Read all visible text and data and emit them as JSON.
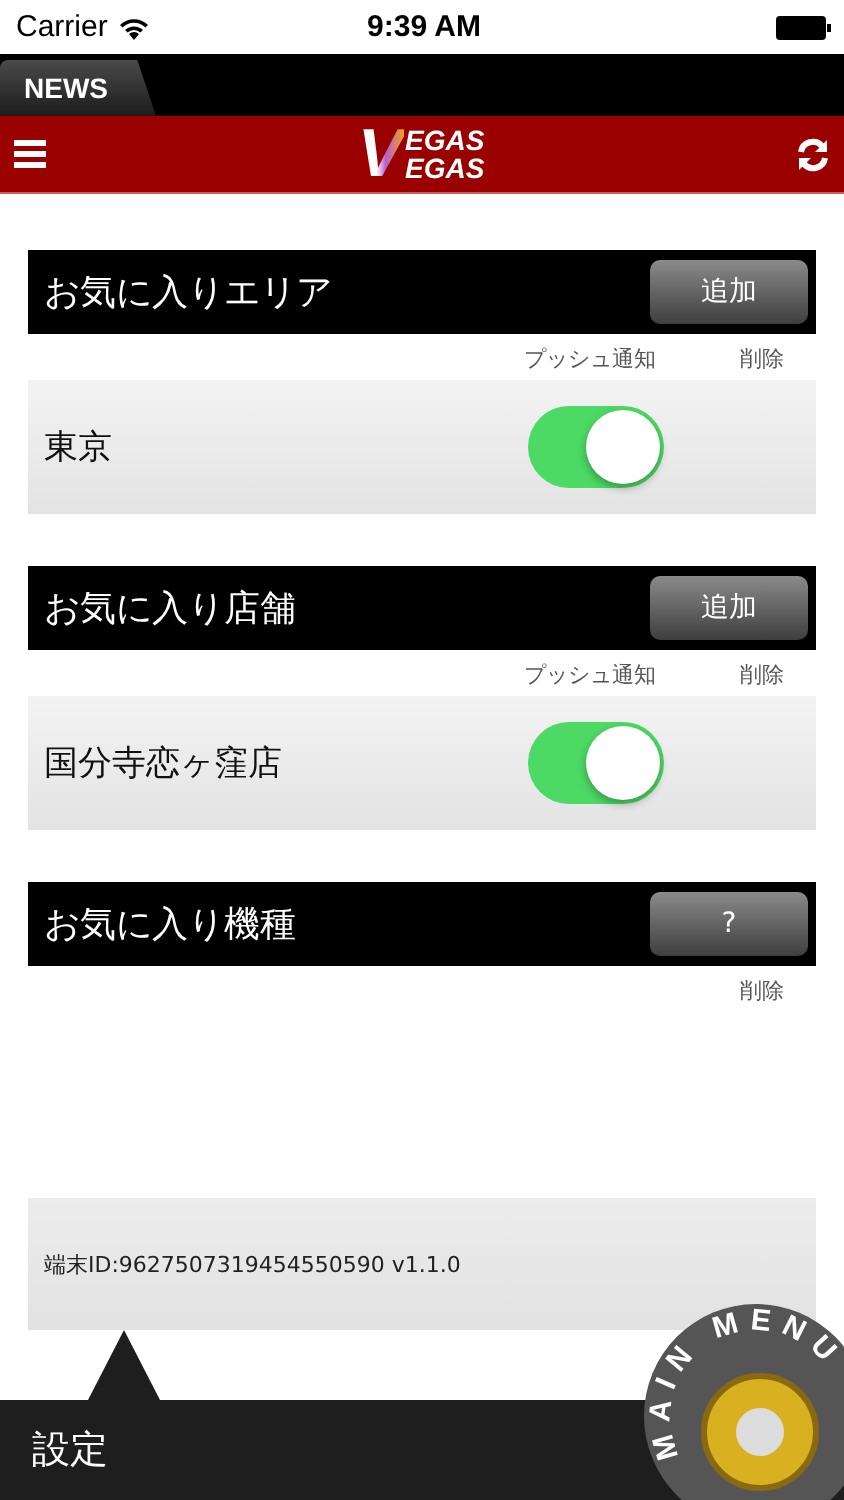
{
  "status_bar": {
    "carrier": "Carrier",
    "time": "9:39 AM"
  },
  "news_tab": {
    "label": "NEWS"
  },
  "nav": {
    "logo": {
      "initial": "V",
      "top": "EGAS",
      "bottom": "EGAS"
    }
  },
  "sections": [
    {
      "title": "お気に入りエリア",
      "button": "追加",
      "columns": [
        {
          "kind": "push",
          "label": "プッシュ通知"
        },
        {
          "kind": "delete",
          "label": "削除"
        }
      ],
      "items": [
        {
          "name": "東京",
          "push_on": true
        }
      ]
    },
    {
      "title": "お気に入り店舗",
      "button": "追加",
      "columns": [
        {
          "kind": "push",
          "label": "プッシュ通知"
        },
        {
          "kind": "delete",
          "label": "削除"
        }
      ],
      "items": [
        {
          "name": "国分寺恋ヶ窪店",
          "push_on": true
        }
      ]
    },
    {
      "title": "お気に入り機種",
      "button": "?",
      "columns": [
        {
          "kind": "delete",
          "label": "削除"
        }
      ]
    }
  ],
  "device_info": "端末ID:9627507319454550590 v1.1.0",
  "bottom_bar": {
    "title": "設定",
    "main_menu": "MAIN MENU"
  }
}
